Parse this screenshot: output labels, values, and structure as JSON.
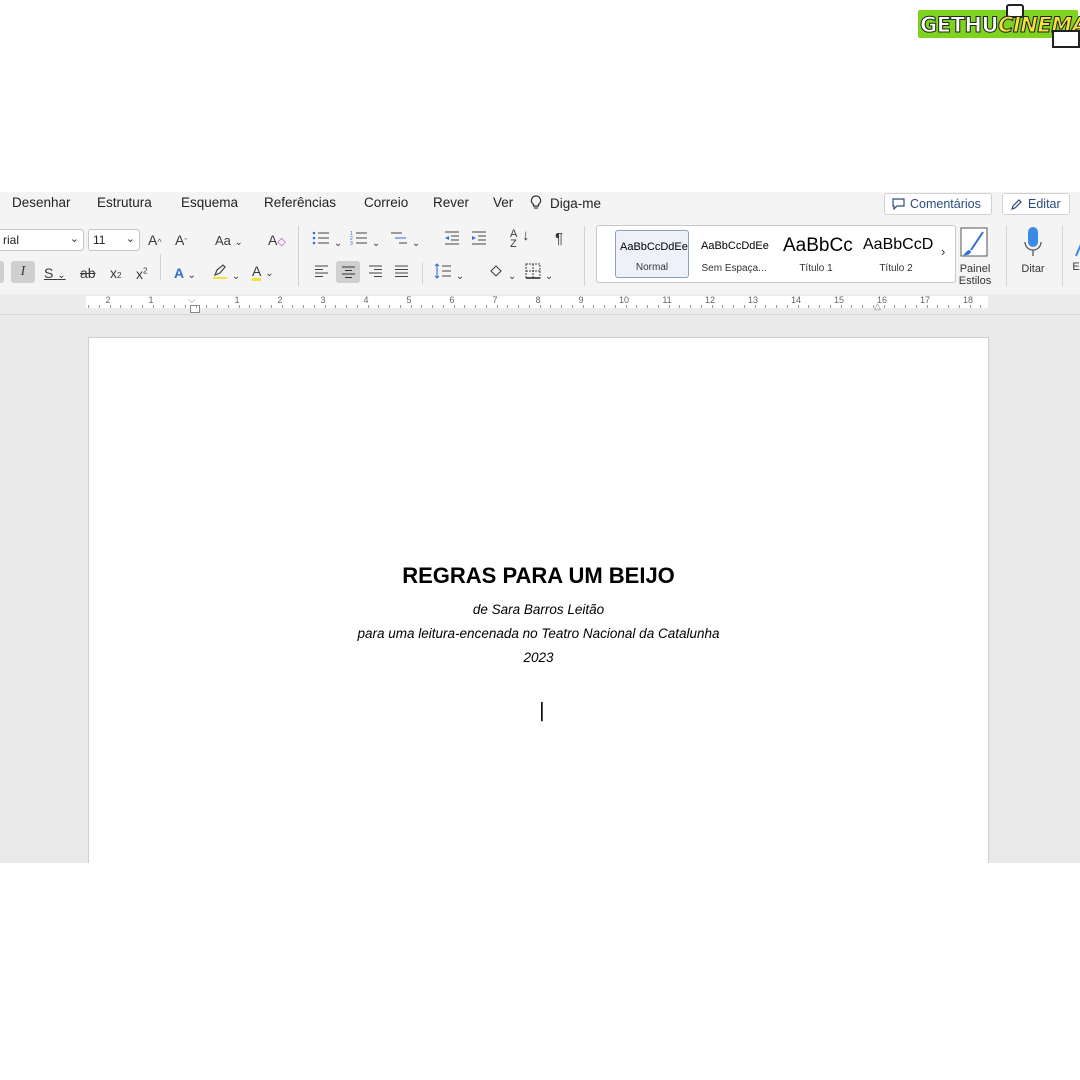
{
  "watermark": {
    "part1": "GETHU",
    "part2": "CINEMA"
  },
  "menubar": {
    "items": [
      "Desenhar",
      "Estrutura",
      "Esquema",
      "Referências",
      "Correio",
      "Rever",
      "Ver"
    ],
    "tell_me": "Diga-me",
    "comments_label": "Comentários",
    "edit_label": "Editar"
  },
  "ribbon": {
    "font_name": "rial",
    "font_size": "11",
    "change_case_label": "Aa",
    "styles": [
      {
        "sample": "AaBbCcDdEe",
        "name": "Normal",
        "selected": true
      },
      {
        "sample": "AaBbCcDdEe",
        "name": "Sem Espaça..."
      },
      {
        "sample": "AaBbCc",
        "name": "Título 1"
      },
      {
        "sample": "AaBbCcD",
        "name": "Título 2"
      }
    ],
    "styles_pane_line1": "Painel",
    "styles_pane_line2": "Estilos",
    "dictate_label": "Ditar",
    "cut_off_label": "E",
    "colors": {
      "highlight": "#f2e33c",
      "font_color": "#f2e33c",
      "accent_blue": "#2f6fd8"
    }
  },
  "ruler": {
    "left_numbers": [
      "2",
      "1"
    ],
    "right_numbers": [
      "1",
      "2",
      "3",
      "4",
      "5",
      "6",
      "7",
      "8",
      "9",
      "10",
      "11",
      "12",
      "13",
      "14",
      "15",
      "16",
      "17",
      "18"
    ]
  },
  "document": {
    "title": "REGRAS PARA UM BEIJO",
    "line1": "de Sara Barros Leitão",
    "line2": "para uma leitura-encenada no Teatro Nacional da Catalunha",
    "line3": "2023"
  }
}
